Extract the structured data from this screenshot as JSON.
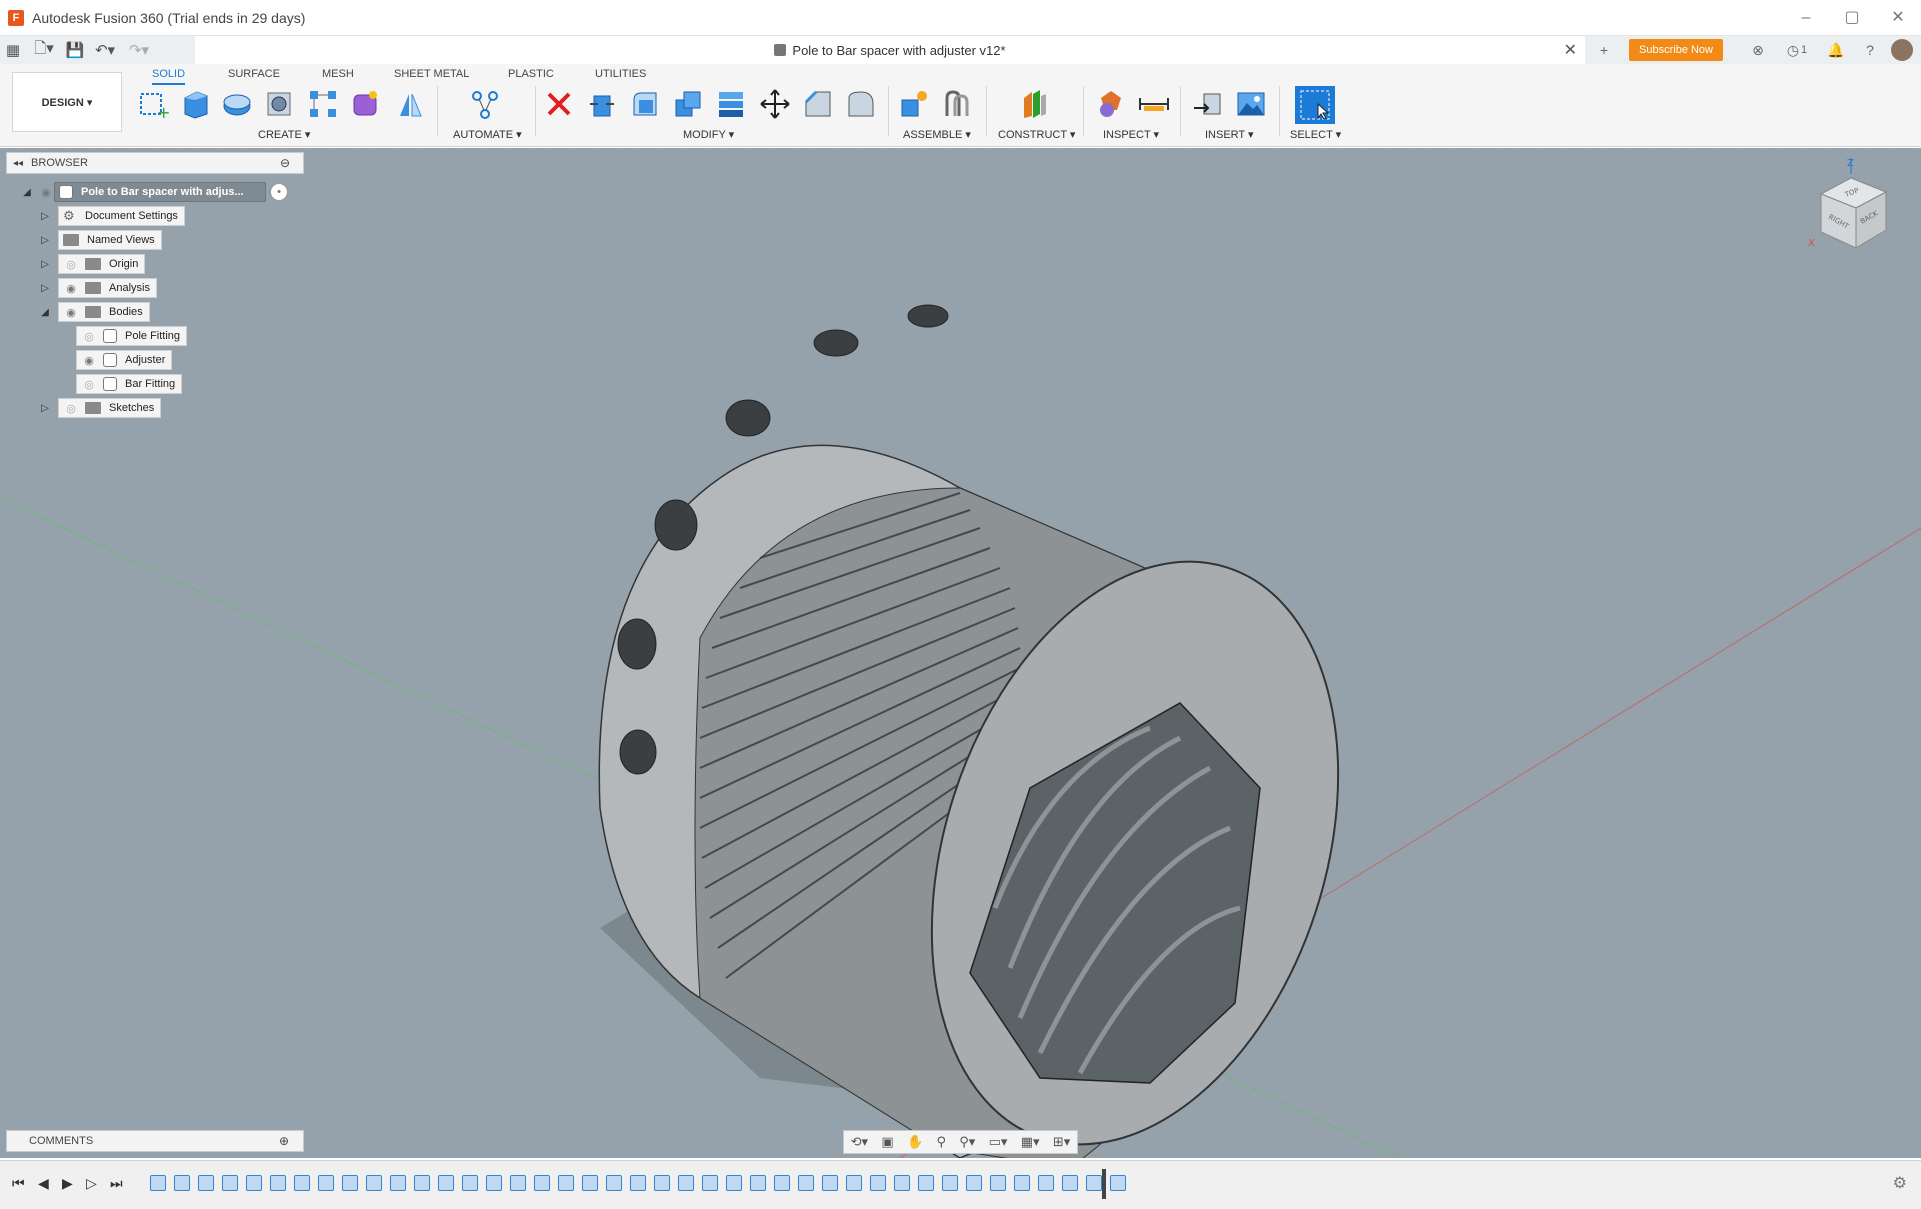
{
  "window": {
    "title": "Autodesk Fusion 360 (Trial ends in 29 days)",
    "controls": [
      "–",
      "▢",
      "✕"
    ]
  },
  "document": {
    "tab_title": "Pole to Bar spacer with adjuster v12*",
    "subscribe_label": "Subscribe Now",
    "notification_count": "1"
  },
  "workspace": {
    "label": "DESIGN ▾"
  },
  "toolbar": {
    "tabs": [
      "SOLID",
      "SURFACE",
      "MESH",
      "SHEET METAL",
      "PLASTIC",
      "UTILITIES"
    ],
    "active_tab": "SOLID",
    "groups": {
      "create": "CREATE ▾",
      "automate": "AUTOMATE ▾",
      "modify": "MODIFY ▾",
      "assemble": "ASSEMBLE ▾",
      "construct": "CONSTRUCT ▾",
      "inspect": "INSPECT ▾",
      "insert": "INSERT ▾",
      "select": "SELECT ▾"
    },
    "accent_color": "#1c7bd6"
  },
  "browser": {
    "header": "BROWSER",
    "root": "Pole to Bar spacer with adjus...",
    "items": [
      {
        "label": "Document Settings",
        "icon": "gear-icon"
      },
      {
        "label": "Named Views",
        "icon": "folder-icon"
      },
      {
        "label": "Origin",
        "icon": "folder-icon"
      },
      {
        "label": "Analysis",
        "icon": "folder-icon"
      },
      {
        "label": "Bodies",
        "icon": "folder-icon",
        "expanded": true
      },
      {
        "label": "Pole Fitting",
        "icon": "body-icon"
      },
      {
        "label": "Adjuster",
        "icon": "body-icon"
      },
      {
        "label": "Bar Fitting",
        "icon": "body-icon"
      },
      {
        "label": "Sketches",
        "icon": "folder-icon"
      }
    ]
  },
  "viewcube": {
    "top": "TOP",
    "right": "RIGHT",
    "back": "BACK",
    "axis_z": "Z",
    "axis_x": "X"
  },
  "comments": {
    "label": "COMMENTS"
  },
  "timeline": {
    "feature_count": 41
  }
}
